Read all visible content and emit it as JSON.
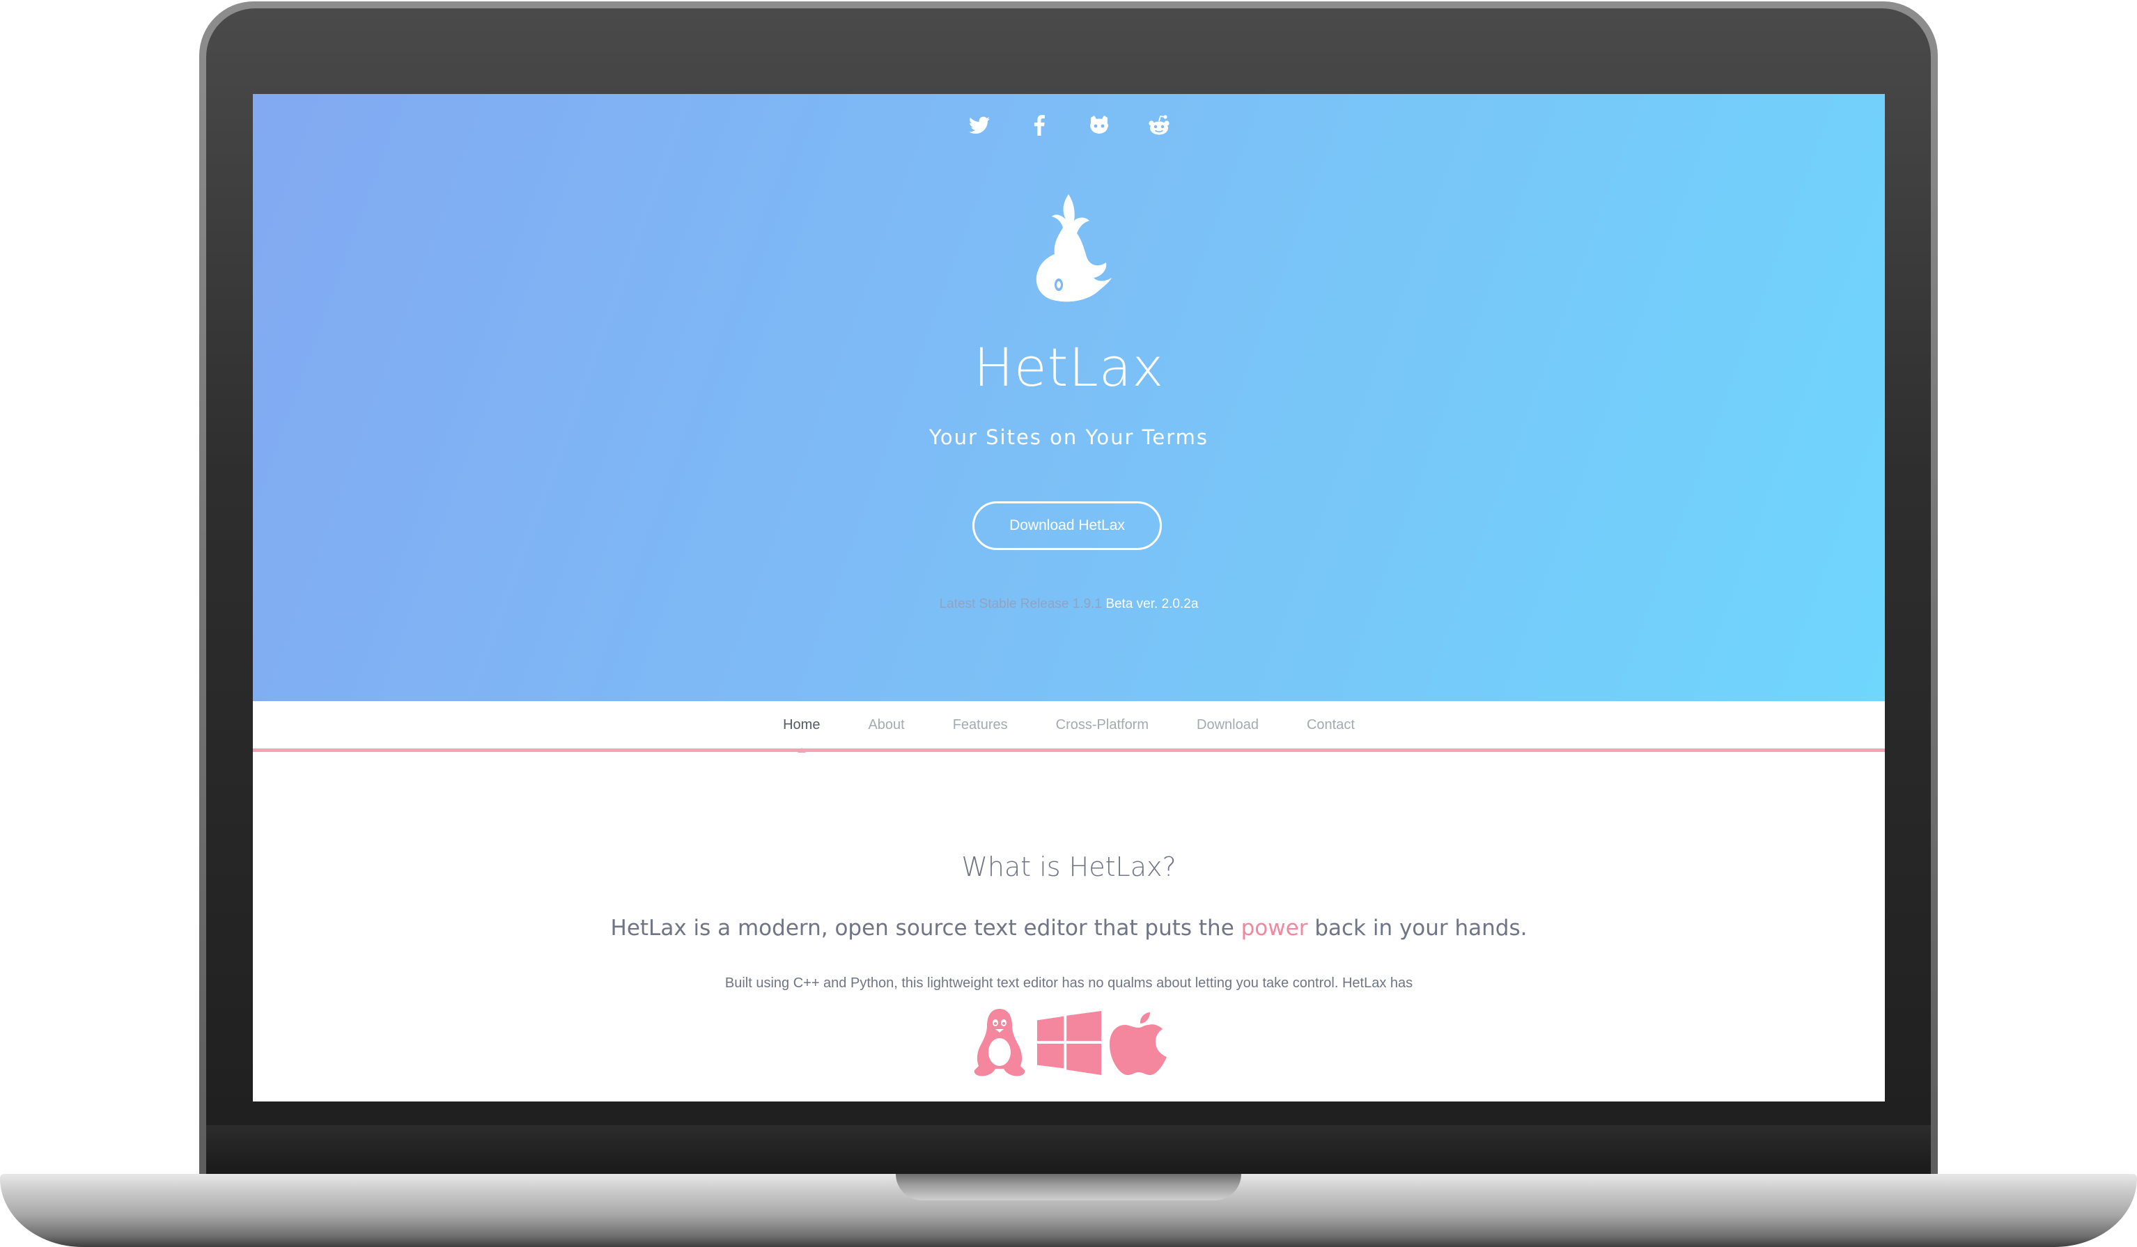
{
  "colors": {
    "hero_gradient_start": "#82a9f2",
    "hero_gradient_end": "#6fd6fc",
    "accent_pink": "#f4879d",
    "nav_underline": "#f4a3b3",
    "text_gray": "#6f7585"
  },
  "social": [
    {
      "icon": "twitter-icon"
    },
    {
      "icon": "facebook-icon"
    },
    {
      "icon": "github-icon"
    },
    {
      "icon": "reddit-icon"
    }
  ],
  "hero": {
    "logo": "whale-logo",
    "title": "HetLax",
    "subtitle": "Your Sites on Your Terms",
    "download_label": "Download HetLax",
    "release_stable": "Latest Stable Release 1.9.1",
    "release_beta": "Beta ver. 2.0.2a"
  },
  "nav": {
    "items": [
      {
        "label": "Home",
        "active": true
      },
      {
        "label": "About",
        "active": false
      },
      {
        "label": "Features",
        "active": false
      },
      {
        "label": "Cross-Platform",
        "active": false
      },
      {
        "label": "Download",
        "active": false
      },
      {
        "label": "Contact",
        "active": false
      }
    ]
  },
  "about": {
    "title": "What is HetLax?",
    "lead_before": "HetLax is a modern, open source text editor that puts the",
    "lead_accent": "power",
    "lead_after": "back in your hands.",
    "body": "Built using C++ and Python, this lightweight text editor has no qualms about letting you take control. HetLax has"
  },
  "platforms": [
    {
      "icon": "linux-icon"
    },
    {
      "icon": "windows-icon"
    },
    {
      "icon": "apple-icon"
    }
  ]
}
